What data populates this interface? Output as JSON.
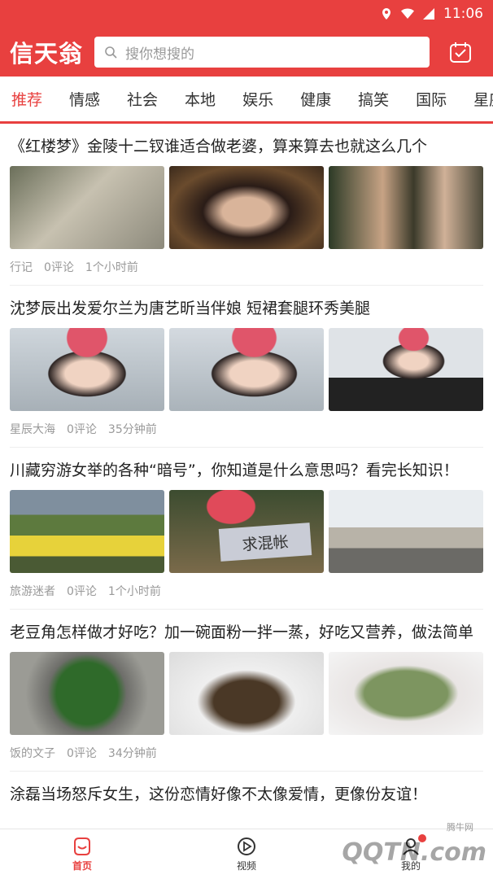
{
  "status": {
    "time": "11:06"
  },
  "header": {
    "logo": "信天翁",
    "search_placeholder": "搜你想搜的",
    "brand_color": "#e8403f"
  },
  "tabs": [
    "推荐",
    "情感",
    "社会",
    "本地",
    "娱乐",
    "健康",
    "搞笑",
    "国际",
    "星座"
  ],
  "articles": [
    {
      "title": "《红楼梦》金陵十二钗谁适合做老婆，算来算去也就这么几个",
      "source": "行记",
      "comments": "0评论",
      "time": "1个小时前",
      "images": [
        "opera-women-photo",
        "opera-headdress-photo",
        "drama-stills-photo"
      ]
    },
    {
      "title": "沈梦辰出发爱尔兰为唐艺昕当伴娘 短裙套腿环秀美腿",
      "source": "星辰大海",
      "comments": "0评论",
      "time": "35分钟前",
      "images": [
        "airport-pink-cap-photo",
        "airport-pink-cap-photo-2",
        "airport-peace-sign-photo"
      ]
    },
    {
      "title": "川藏穷游女举的各种“暗号”，你知道是什么意思吗？看完长知识！",
      "source": "旅游迷者",
      "comments": "0评论",
      "time": "1个小时前",
      "images": [
        "hitchhiker-signs-photo",
        "hitchhiker-sign-closeup-photo",
        "backpackers-road-photo"
      ],
      "sign_text": "求混帐"
    },
    {
      "title": "老豆角怎样做才好吃？加一碗面粉一拌一蒸，好吃又营养，做法简单",
      "source": "饭的文子",
      "comments": "0评论",
      "time": "34分钟前",
      "images": [
        "green-beans-pot-photo",
        "soup-bowl-photo",
        "steamed-beans-plate-photo"
      ]
    },
    {
      "title": "涂磊当场怒斥女生，这份恋情好像不太像爱情，更像份友谊！"
    }
  ],
  "bottom_nav": [
    {
      "label": "首页",
      "icon": "home-icon",
      "active": true
    },
    {
      "label": "视频",
      "icon": "video-icon",
      "active": false
    },
    {
      "label": "我的",
      "icon": "user-icon",
      "active": false
    }
  ],
  "watermark": {
    "text": "QQTN.com",
    "sub": "腾牛网"
  }
}
